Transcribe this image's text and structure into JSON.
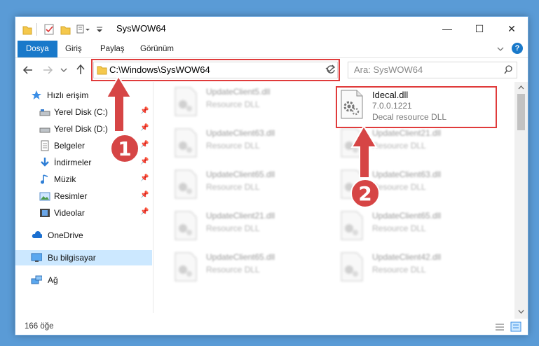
{
  "window": {
    "title": "SysWOW64",
    "minimize": "—",
    "maximize": "☐",
    "close": "✕"
  },
  "ribbon": {
    "tabs": [
      "Dosya",
      "Giriş",
      "Paylaş",
      "Görünüm"
    ],
    "help": "?"
  },
  "address": {
    "path": "C:\\Windows\\SysWOW64",
    "search_placeholder": "Ara: SysWOW64"
  },
  "nav_pane": {
    "quick_access": "Hızlı erişim",
    "items": [
      {
        "label": "Yerel Disk (C:)",
        "pinned": true
      },
      {
        "label": "Yerel Disk (D:)",
        "pinned": true
      },
      {
        "label": "Belgeler",
        "pinned": true
      },
      {
        "label": "İndirmeler",
        "pinned": true
      },
      {
        "label": "Müzik",
        "pinned": true
      },
      {
        "label": "Resimler",
        "pinned": true
      },
      {
        "label": "Videolar",
        "pinned": true
      }
    ],
    "onedrive": "OneDrive",
    "this_pc": "Bu bilgisayar",
    "network": "Ağ"
  },
  "files": {
    "left": [
      {
        "name": "UpdateClient5.dll",
        "desc": "Resource DLL"
      },
      {
        "name": "UpdateClient63.dll",
        "desc": "Resource DLL"
      },
      {
        "name": "UpdateClient65.dll",
        "desc": "Resource DLL"
      },
      {
        "name": "UpdateClient21.dll",
        "desc": "Resource DLL"
      },
      {
        "name": "UpdateClient65.dll",
        "desc": "Resource DLL"
      }
    ],
    "highlight": {
      "name": "Idecal.dll",
      "version": "7.0.0.1221",
      "desc": "Decal resource DLL"
    },
    "right": [
      {
        "name": "UpdateClient21.dll",
        "desc": "Resource DLL"
      },
      {
        "name": "UpdateClient63.dll",
        "desc": "Resource DLL"
      },
      {
        "name": "UpdateClient65.dll",
        "desc": "Resource DLL"
      },
      {
        "name": "UpdateClient42.dll",
        "desc": "Resource DLL"
      }
    ]
  },
  "status": {
    "count": "166 öğe"
  },
  "annotations": {
    "step1": "1",
    "step2": "2"
  },
  "colors": {
    "accent": "#1979ca",
    "highlight": "#e03b3b",
    "arrow": "#d64545"
  }
}
